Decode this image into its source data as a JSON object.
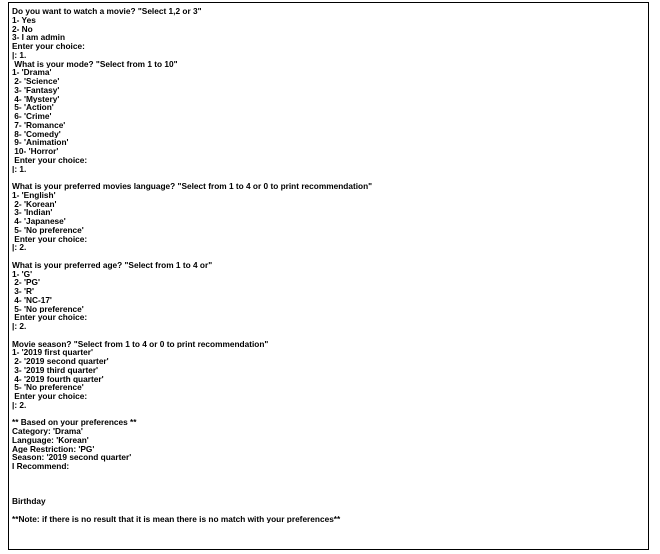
{
  "console": {
    "lines": [
      "Do you want to watch a movie? \"Select 1,2 or 3\"",
      "1- Yes",
      "2- No",
      "3- I am admin",
      "Enter your choice:",
      "|: 1.",
      " What is your mode? \"Select from 1 to 10\"",
      "1- 'Drama'",
      " 2- 'Science'",
      " 3- 'Fantasy'",
      " 4- 'Mystery'",
      " 5- 'Action'",
      " 6- 'Crime'",
      " 7- 'Romance'",
      " 8- 'Comedy'",
      " 9- 'Animation'",
      " 10- 'Horror'",
      " Enter your choice:",
      "|: 1.",
      "",
      "What is your preferred movies language? \"Select from 1 to 4 or 0 to print recommendation\"",
      "1- 'English'",
      " 2- 'Korean'",
      " 3- 'Indian'",
      " 4- 'Japanese'",
      " 5- 'No preference'",
      " Enter your choice:",
      "|: 2.",
      "",
      "What is your preferred age? \"Select from 1 to 4 or\"",
      "1- 'G'",
      " 2- 'PG'",
      " 3- 'R'",
      " 4- 'NC-17'",
      " 5- 'No preference'",
      " Enter your choice:",
      "|: 2.",
      "",
      "Movie season? \"Select from 1 to 4 or 0 to print recommendation\"",
      "1- '2019 first quarter'",
      " 2- '2019 second quarter'",
      " 3- '2019 third quarter'",
      " 4- '2019 fourth quarter'",
      " 5- 'No preference'",
      " Enter your choice:",
      "|: 2.",
      "",
      "** Based on your preferences **",
      "Category: 'Drama'",
      "Language: 'Korean'",
      "Age Restriction: 'PG'",
      "Season: '2019 second quarter'",
      "I Recommend:",
      "",
      "",
      "",
      "Birthday",
      "",
      "**Note: if there is no result that it is mean there is no match with your preferences**"
    ]
  }
}
